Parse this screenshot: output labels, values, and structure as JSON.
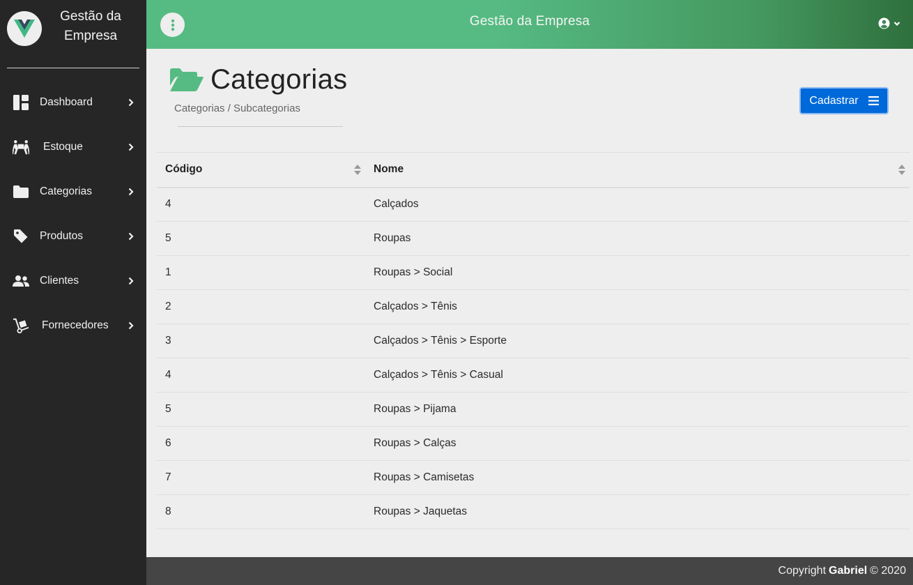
{
  "app": {
    "brand_line1": "Gestão da",
    "brand_line2": "Empresa",
    "header_title": "Gestão da Empresa"
  },
  "sidebar": {
    "items": [
      {
        "label": "Dashboard",
        "icon": "dashboard-icon"
      },
      {
        "label": "Estoque",
        "icon": "people-carry-icon"
      },
      {
        "label": "Categorias",
        "icon": "folder-icon"
      },
      {
        "label": "Produtos",
        "icon": "tag-icon"
      },
      {
        "label": "Clientes",
        "icon": "users-icon"
      },
      {
        "label": "Fornecedores",
        "icon": "dolly-icon"
      }
    ]
  },
  "page": {
    "title": "Categorias",
    "breadcrumb": "Categorias / Subcategorias",
    "register_button": "Cadastrar"
  },
  "table": {
    "columns": [
      "Código",
      "Nome"
    ],
    "rows": [
      {
        "code": "4",
        "name": "Calçados"
      },
      {
        "code": "5",
        "name": "Roupas"
      },
      {
        "code": "1",
        "name": "Roupas > Social"
      },
      {
        "code": "2",
        "name": "Calçados > Tênis"
      },
      {
        "code": "3",
        "name": "Calçados > Tênis > Esporte"
      },
      {
        "code": "4",
        "name": "Calçados > Tênis > Casual"
      },
      {
        "code": "5",
        "name": "Roupas > Pijama"
      },
      {
        "code": "6",
        "name": "Roupas > Calças"
      },
      {
        "code": "7",
        "name": "Roupas > Camisetas"
      },
      {
        "code": "8",
        "name": "Roupas > Jaquetas"
      }
    ]
  },
  "footer": {
    "prefix": "Copyright",
    "author": "Gabriel",
    "suffix": "© 2020"
  },
  "colors": {
    "header_green": "#56bb83",
    "header_dark": "#2f6f3d",
    "sidebar_bg": "#262626",
    "button_blue": "#0069d9",
    "folder_green": "#56bb83"
  }
}
